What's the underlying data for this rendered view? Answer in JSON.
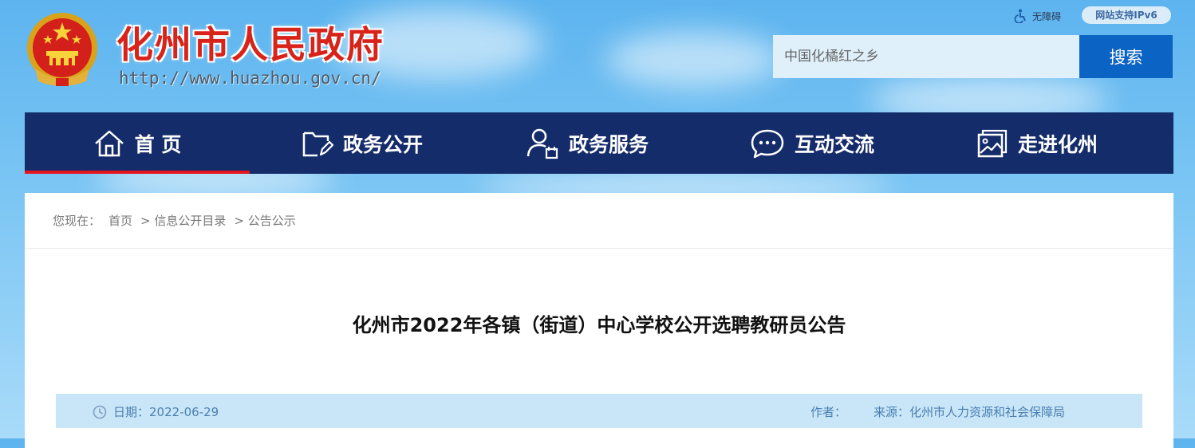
{
  "header": {
    "site_title": "化州市人民政府",
    "site_url": "http://www.huazhou.gov.cn/",
    "accessibility_label": "无障碍",
    "ipv6_badge": "网站支持IPv6",
    "search": {
      "placeholder": "中国化橘红之乡",
      "button_label": "搜索"
    }
  },
  "nav": {
    "items": [
      {
        "label": "首 页",
        "icon": "home-icon",
        "active": true
      },
      {
        "label": "政务公开",
        "icon": "folder-edit-icon"
      },
      {
        "label": "政务服务",
        "icon": "user-calendar-icon"
      },
      {
        "label": "互动交流",
        "icon": "chat-bubble-icon"
      },
      {
        "label": "走进化州",
        "icon": "picture-icon"
      }
    ]
  },
  "breadcrumb": {
    "prefix": "您现在：",
    "items": [
      "首页",
      "> 信息公开目录",
      "> 公告公示"
    ]
  },
  "article": {
    "title": "化州市2022年各镇（街道）中心学校公开选聘教研员公告",
    "date_label": "日期：",
    "date": "2022-06-29",
    "author_label": "作者：",
    "author": "",
    "source_label": "来源：",
    "source": "化州市人力资源和社会保障局"
  },
  "colors": {
    "nav_bg": "#152c6b",
    "nav_active_underline": "#e4151f",
    "title_red": "#d8231a",
    "search_button": "#0b63c3",
    "meta_bar_bg": "#c9e6f8"
  }
}
